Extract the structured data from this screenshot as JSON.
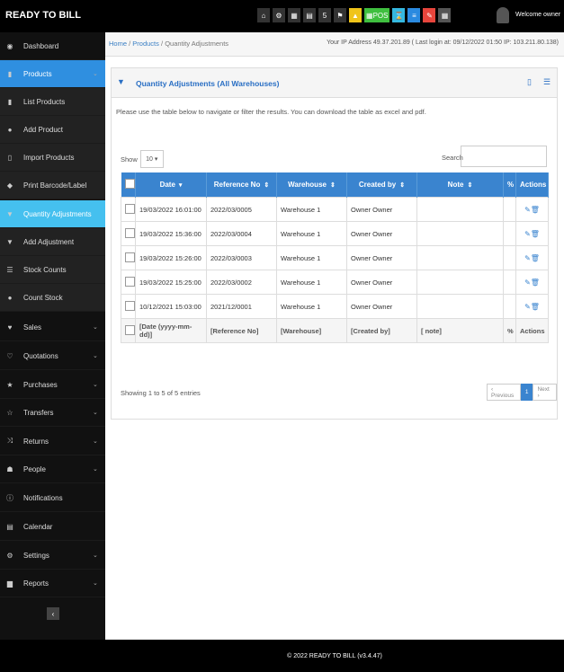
{
  "app": {
    "brand": "READY TO BILL",
    "welcome": "Welcome owner",
    "footer": "© 2022 READY TO BILL (v3.4.47)"
  },
  "toolbar": {
    "pos_label": "POS",
    "icons": [
      "home-icon",
      "settings-icon",
      "calculator-icon",
      "calendar-icon",
      "html5-icon",
      "flag-icon",
      "alert-icon",
      "pos-icon",
      "hourglass-icon",
      "list-icon",
      "eraser-icon",
      "grid-icon"
    ]
  },
  "sidebar": {
    "items": [
      {
        "label": "Dashboard",
        "icon": "dashboard-icon",
        "chevron": false
      },
      {
        "label": "Products",
        "icon": "barcode-icon",
        "chevron": true
      },
      {
        "label": "List Products",
        "icon": "barcode-icon",
        "chevron": false
      },
      {
        "label": "Add Product",
        "icon": "plus-circle-icon",
        "chevron": false
      },
      {
        "label": "Import Products",
        "icon": "file-icon",
        "chevron": false
      },
      {
        "label": "Print Barcode/Label",
        "icon": "tag-icon",
        "chevron": false
      },
      {
        "label": "Quantity Adjustments",
        "icon": "filter-icon",
        "chevron": false
      },
      {
        "label": "Add Adjustment",
        "icon": "filter-icon",
        "chevron": false
      },
      {
        "label": "Stock Counts",
        "icon": "list-icon",
        "chevron": false
      },
      {
        "label": "Count Stock",
        "icon": "plus-circle-icon",
        "chevron": false
      },
      {
        "label": "Sales",
        "icon": "heart-icon",
        "chevron": true
      },
      {
        "label": "Quotations",
        "icon": "heart-outline-icon",
        "chevron": true
      },
      {
        "label": "Purchases",
        "icon": "star-icon",
        "chevron": true
      },
      {
        "label": "Transfers",
        "icon": "star-outline-icon",
        "chevron": true
      },
      {
        "label": "Returns",
        "icon": "random-icon",
        "chevron": true
      },
      {
        "label": "People",
        "icon": "users-icon",
        "chevron": true
      },
      {
        "label": "Notifications",
        "icon": "info-icon",
        "chevron": false
      },
      {
        "label": "Calendar",
        "icon": "calendar-icon",
        "chevron": false
      },
      {
        "label": "Settings",
        "icon": "gear-icon",
        "chevron": true
      },
      {
        "label": "Reports",
        "icon": "bar-chart-icon",
        "chevron": true
      }
    ],
    "collapse_label": "‹"
  },
  "breadcrumb": {
    "home": "Home",
    "sep": "/",
    "products": "Products",
    "current": "Quantity Adjustments"
  },
  "ipinfo": "Your IP Address 49.37.201.89 ( Last login at: 09/12/2022 01:50 IP: 103.211.80.138)",
  "panel": {
    "title": "Quantity Adjustments (All Warehouses)",
    "intro": "Please use the table below to navigate or filter the results. You can download the table as excel and pdf.",
    "show_label": "Show",
    "show_value": "10",
    "search_label": "Search",
    "columns": [
      "Date",
      "Reference No",
      "Warehouse",
      "Created by",
      "Note",
      "",
      "Actions"
    ],
    "rows": [
      {
        "date": "19/03/2022 16:01:00",
        "ref": "2022/03/0005",
        "warehouse": "Warehouse 1",
        "created_by": "Owner Owner",
        "note": ""
      },
      {
        "date": "19/03/2022 15:36:00",
        "ref": "2022/03/0004",
        "warehouse": "Warehouse 1",
        "created_by": "Owner Owner",
        "note": ""
      },
      {
        "date": "19/03/2022 15:26:00",
        "ref": "2022/03/0003",
        "warehouse": "Warehouse 1",
        "created_by": "Owner Owner",
        "note": ""
      },
      {
        "date": "19/03/2022 15:25:00",
        "ref": "2022/03/0002",
        "warehouse": "Warehouse 1",
        "created_by": "Owner Owner",
        "note": ""
      },
      {
        "date": "10/12/2021 15:03:00",
        "ref": "2021/12/0001",
        "warehouse": "Warehouse 1",
        "created_by": "Owner Owner",
        "note": ""
      }
    ],
    "filters": {
      "date": "[Date (yyyy-mm-dd)]",
      "ref": "[Reference No]",
      "warehouse": "[Warehouse]",
      "created_by": "[Created by]",
      "note": "[ note]",
      "actions": "Actions"
    },
    "info": "Showing 1 to 5 of 5 entries",
    "pager": {
      "prev": "‹ Previous",
      "current": "1",
      "next": "Next ›"
    }
  }
}
